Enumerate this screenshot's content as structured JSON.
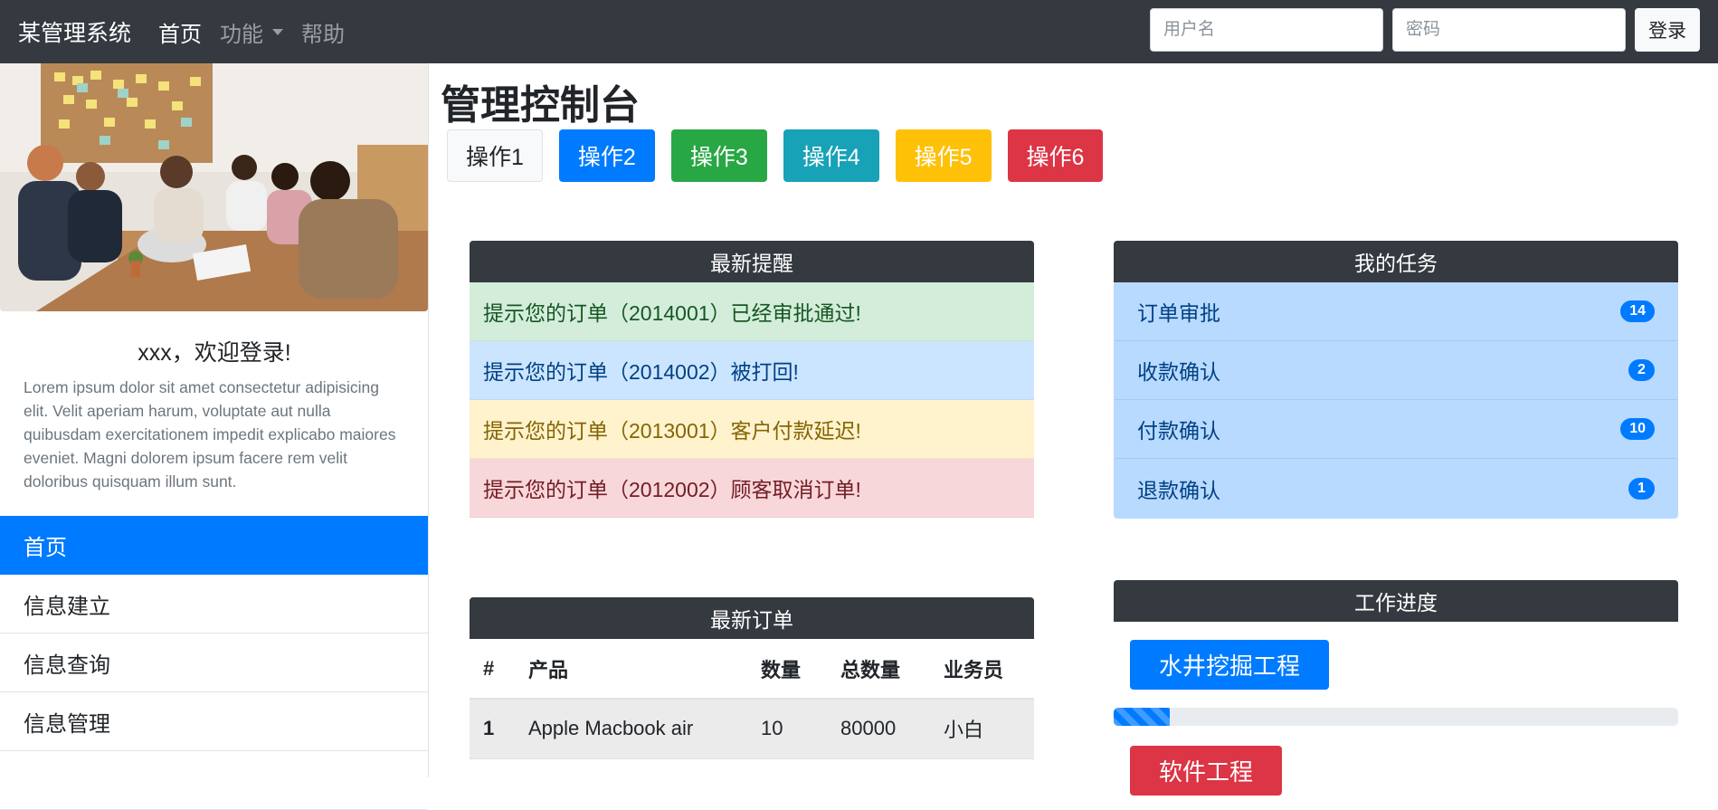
{
  "navbar": {
    "brand": "某管理系统",
    "links": [
      {
        "label": "首页",
        "active": true
      },
      {
        "label": "功能",
        "dropdown": true
      },
      {
        "label": "帮助"
      }
    ],
    "username_placeholder": "用户名",
    "password_placeholder": "密码",
    "login_label": "登录"
  },
  "sidebar": {
    "welcome": "xxx，欢迎登录!",
    "description": "Lorem ipsum dolor sit amet consectetur adipisicing elit. Velit aperiam harum, voluptate aut nulla quibusdam exercitationem impedit explicabo maiores eveniet. Magni dolorem ipsum facere rem velit doloribus quisquam illum sunt.",
    "nav": [
      {
        "label": "首页",
        "active": true
      },
      {
        "label": "信息建立"
      },
      {
        "label": "信息查询"
      },
      {
        "label": "信息管理"
      }
    ]
  },
  "main": {
    "title": "管理控制台",
    "buttons": [
      {
        "label": "操作1",
        "variant": "light"
      },
      {
        "label": "操作2",
        "variant": "primary"
      },
      {
        "label": "操作3",
        "variant": "success"
      },
      {
        "label": "操作4",
        "variant": "info"
      },
      {
        "label": "操作5",
        "variant": "warning"
      },
      {
        "label": "操作6",
        "variant": "danger"
      }
    ]
  },
  "reminders": {
    "title": "最新提醒",
    "items": [
      {
        "text": "提示您的订单（2014001）已经审批通过!",
        "variant": "success"
      },
      {
        "text": "提示您的订单（2014002）被打回!",
        "variant": "primary"
      },
      {
        "text": "提示您的订单（2013001）客户付款延迟!",
        "variant": "warning"
      },
      {
        "text": "提示您的订单（2012002）顾客取消订单!",
        "variant": "danger"
      }
    ]
  },
  "tasks": {
    "title": "我的任务",
    "items": [
      {
        "label": "订单审批",
        "count": "14"
      },
      {
        "label": "收款确认",
        "count": "2"
      },
      {
        "label": "付款确认",
        "count": "10"
      },
      {
        "label": "退款确认",
        "count": "1"
      }
    ]
  },
  "orders": {
    "title": "最新订单",
    "columns": [
      "#",
      "产品",
      "数量",
      "总数量",
      "业务员"
    ],
    "rows": [
      [
        "1",
        "Apple Macbook air",
        "10",
        "80000",
        "小白"
      ]
    ]
  },
  "progress": {
    "title": "工作进度",
    "projects": [
      {
        "label": "水井挖掘工程",
        "variant": "primary",
        "percent": 10
      },
      {
        "label": "软件工程",
        "variant": "danger"
      }
    ]
  },
  "colors": {
    "navbar_bg": "#343a40",
    "primary": "#007bff",
    "success": "#28a745",
    "info": "#17a2b8",
    "warning": "#ffc107",
    "danger": "#dc3545"
  }
}
